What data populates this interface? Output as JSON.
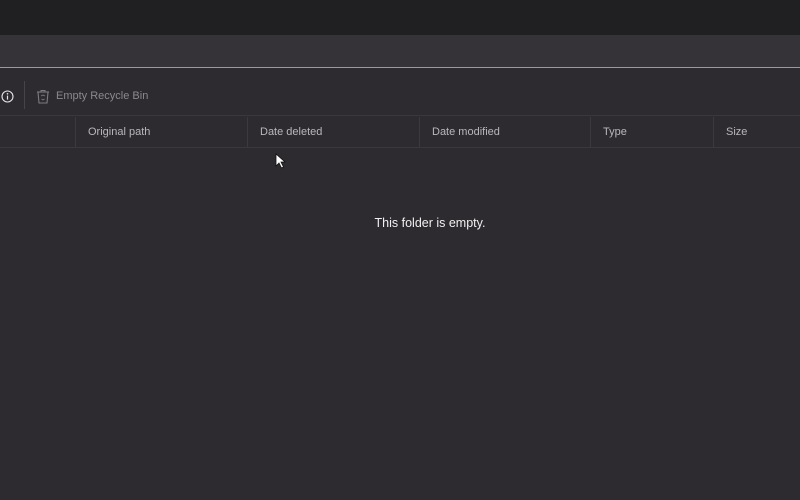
{
  "toolbar": {
    "info_icon": "info-icon",
    "empty_recycle_bin": {
      "icon": "recycle-bin-icon",
      "label": "Empty Recycle Bin"
    }
  },
  "columns": [
    {
      "label": "Original path"
    },
    {
      "label": "Date deleted"
    },
    {
      "label": "Date modified"
    },
    {
      "label": "Type"
    },
    {
      "label": "Size"
    }
  ],
  "empty_message": "This folder is empty.",
  "colors": {
    "background": "#2d2b2f",
    "titlebar": "#201f22",
    "addressbar": "#353338",
    "text": "#f0eff1",
    "muted_text": "#8b898e"
  }
}
